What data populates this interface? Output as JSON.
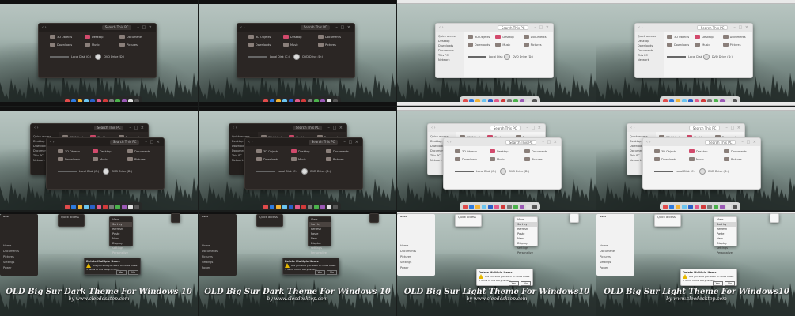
{
  "explorer": {
    "sidebar": [
      "Quick access",
      "Desktop",
      "Downloads",
      "Documents",
      "This PC",
      "Network"
    ],
    "folders": [
      {
        "label": "3D Objects",
        "color": "#8a7f7a"
      },
      {
        "label": "Desktop",
        "color": "#d24a6c"
      },
      {
        "label": "Documents",
        "color": "#8a7f7a"
      },
      {
        "label": "Downloads",
        "color": "#8a7f7a"
      },
      {
        "label": "Music",
        "color": "#8a7f7a"
      },
      {
        "label": "Pictures",
        "color": "#8a7f7a"
      },
      {
        "label": "Videos",
        "color": "#8a7f7a"
      }
    ],
    "drives": [
      "Local Disk (C:)",
      "DVD Drive (D:)"
    ],
    "search_text": "Search This PC",
    "back_label": "Quick access"
  },
  "start_menu": {
    "items": [
      "Home",
      "Documents",
      "Pictures",
      "Settings",
      "Power"
    ],
    "header": "user"
  },
  "context_menu": {
    "items": [
      "View",
      "Sort by",
      "Refresh",
      "Paste",
      "New",
      "Display settings",
      "Personalize"
    ]
  },
  "dialog": {
    "title": "Delete Multiple Items",
    "message": "Are you sure you want to move these 3 items to the Recycle Bin?",
    "yes": "Yes",
    "no": "No"
  },
  "captions": [
    {
      "title": "OLD Big Sur Dark Theme For Windows 10",
      "url": "by www.cleodesktop.com"
    },
    {
      "title": "OLD Big Sur Dark Theme For Windows 10",
      "url": "by www.cleodesktop.com"
    },
    {
      "title": "OLD Big Sur Light Theme For Windows10",
      "url": "by www.cleodesktop.com"
    },
    {
      "title": "OLD Big Sur Light Theme For Windows10",
      "url": "by www.cleodesktop.com"
    }
  ],
  "colors": {
    "dark_window": "#2b2624",
    "light_window": "#f4f4f4",
    "accent_pink": "#d24a6c",
    "warning": "#e6b800"
  },
  "dock_icons": [
    "#e14b4b",
    "#2d7be0",
    "#f2b233",
    "#6bc5f0",
    "#2a62c9",
    "#e35b8a",
    "#d23a3a",
    "#7a7a7a",
    "#4bb24b",
    "#9b59b6",
    "#e0e0e0",
    "#555"
  ]
}
